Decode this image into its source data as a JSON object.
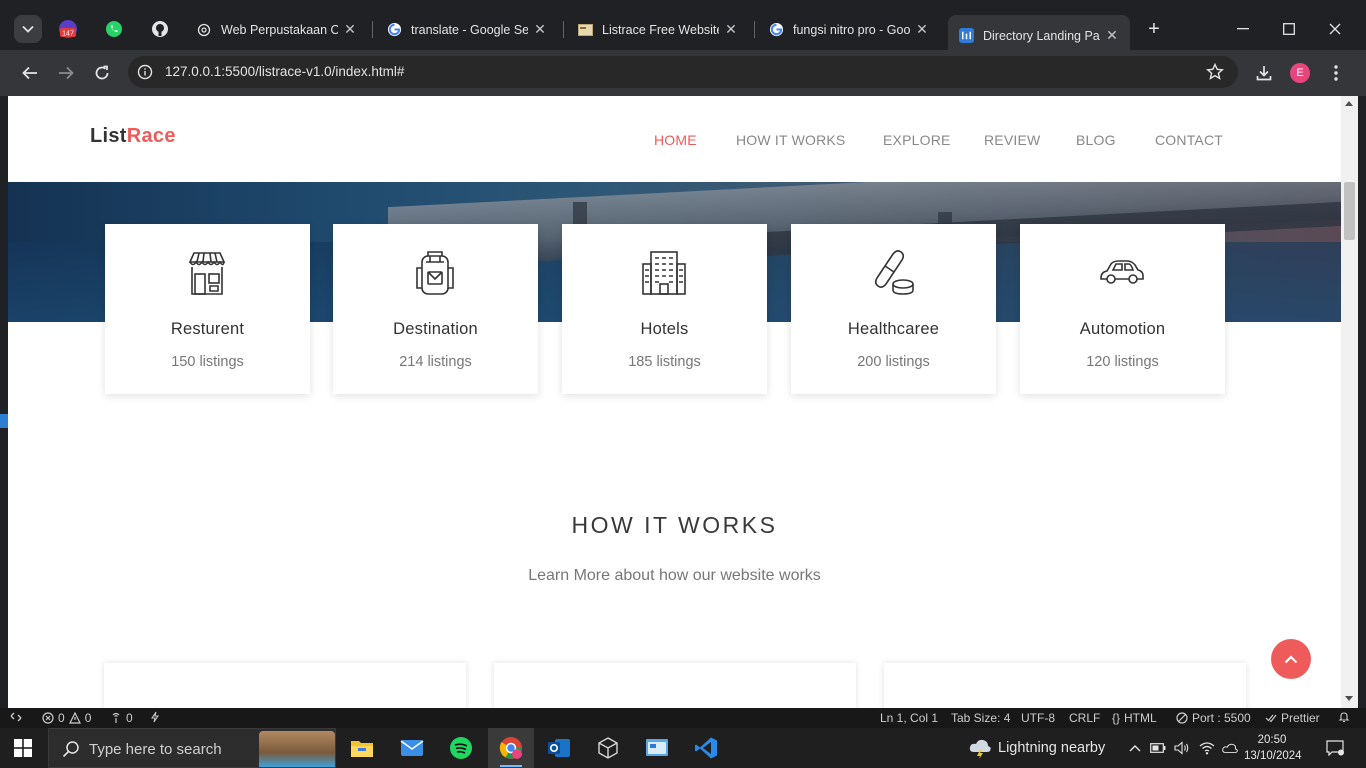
{
  "browser": {
    "pinned_tabs": [
      {
        "name": "notification-badge-icon",
        "badge": "147"
      },
      {
        "name": "whatsapp-icon"
      },
      {
        "name": "github-icon"
      }
    ],
    "tabs": [
      {
        "title": "Web Perpustakaan Onl",
        "favicon": "openai-icon"
      },
      {
        "title": "translate - Google Sea",
        "favicon": "google-icon"
      },
      {
        "title": "Listrace Free Website T",
        "favicon": "template-icon"
      },
      {
        "title": "fungsi nitro pro - Goo",
        "favicon": "google-icon"
      },
      {
        "title": "Directory Landing Pag",
        "favicon": "vscode-live-icon",
        "active": true
      }
    ],
    "url": "127.0.0.1:5500/listrace-v1.0/index.html#",
    "profile_initial": "E"
  },
  "site": {
    "logo_part1": "List",
    "logo_part2": "Race",
    "nav": [
      "HOME",
      "HOW IT WORKS",
      "EXPLORE",
      "REVIEW",
      "BLOG",
      "CONTACT"
    ],
    "categories": [
      {
        "name": "Resturent",
        "count": "150 listings",
        "icon": "store-icon"
      },
      {
        "name": "Destination",
        "count": "214 listings",
        "icon": "backpack-icon"
      },
      {
        "name": "Hotels",
        "count": "185 listings",
        "icon": "building-icon"
      },
      {
        "name": "Healthcaree",
        "count": "200 listings",
        "icon": "pill-icon"
      },
      {
        "name": "Automotion",
        "count": "120 listings",
        "icon": "car-icon"
      }
    ],
    "how_title": "HOW IT WORKS",
    "how_subtitle": "Learn More about how our website works"
  },
  "vscode_status": {
    "errors": "0",
    "warnings": "0",
    "ports": "0",
    "position": "Ln 1, Col 1",
    "tab_size": "Tab Size: 4",
    "encoding": "UTF-8",
    "eol": "CRLF",
    "language": "HTML",
    "port": "Port : 5500",
    "formatter": "Prettier"
  },
  "taskbar": {
    "search_placeholder": "Type here to search",
    "weather": "Lightning nearby",
    "time": "20:50",
    "date": "13/10/2024"
  },
  "colors": {
    "accent": "#ef5b5b"
  }
}
